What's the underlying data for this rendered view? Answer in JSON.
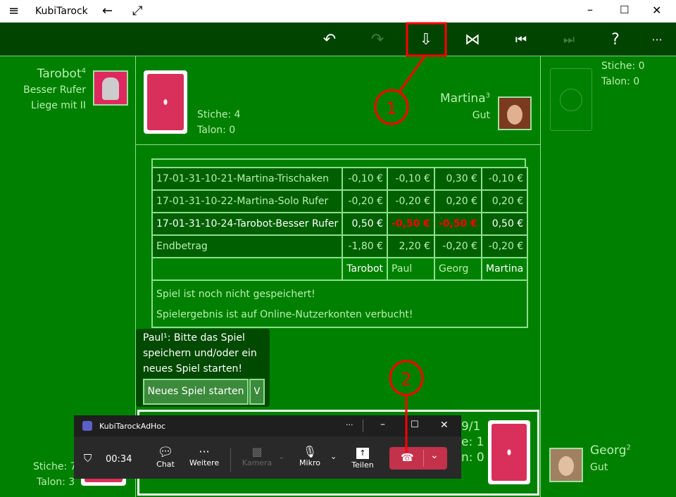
{
  "window": {
    "title": "KubiTarock",
    "menu_icon": "hamburger-icon",
    "back_icon": "arrow-left-icon",
    "expand_icon": "expand-icon"
  },
  "toolbar": {
    "buttons": [
      {
        "name": "undo-icon",
        "glyph": "↶"
      },
      {
        "name": "redo-icon",
        "glyph": "↷"
      },
      {
        "name": "save-icon",
        "glyph": "⇩"
      },
      {
        "name": "bowtie-icon",
        "glyph": "⋈"
      },
      {
        "name": "skip-back-icon",
        "glyph": "⏮"
      },
      {
        "name": "skip-forward-icon",
        "glyph": "⏭"
      },
      {
        "name": "help-icon",
        "glyph": "?"
      },
      {
        "name": "more-icon",
        "glyph": "···"
      }
    ]
  },
  "players": {
    "left": {
      "name": "Tarobot",
      "sup": "4",
      "line1": "Besser Rufer",
      "line2": "Liege mit II",
      "stiche": "Stiche: 7",
      "talon": "Talon: 3"
    },
    "top": {
      "name": "Martina",
      "sup": "3",
      "line1": "Gut",
      "stiche": "Stiche: 4",
      "talon": "Talon: 0"
    },
    "right": {
      "stiche": "Stiche: 0",
      "talon": "Talon: 0"
    },
    "bottom_right": {
      "name": "Georg",
      "sup": "2",
      "line1": "Gut"
    },
    "bottom": {
      "l1": "9/1",
      "l2": "e: 1",
      "l3": "n: 0"
    }
  },
  "table": {
    "rows": [
      {
        "name": "17-01-31-10-21-Martina-Trischaken",
        "v": [
          "-0,10 €",
          "-0,10 €",
          "0,30 €",
          "-0,10 €"
        ]
      },
      {
        "name": "17-01-31-10-22-Martina-Solo Rufer",
        "v": [
          "-0,20 €",
          "-0,20 €",
          "0,20 €",
          "0,20 €"
        ]
      },
      {
        "name": "17-01-31-10-24-Tarobot-Besser Rufer",
        "v": [
          "0,50 €",
          "-0,50 €",
          "-0,50 €",
          "0,50 €"
        ]
      }
    ],
    "total": {
      "name": "Endbetrag",
      "v": [
        "-1,80 €",
        "2,20 €",
        "-0,20 €",
        "-0,20 €"
      ]
    },
    "headers": [
      "Tarobot",
      "Paul",
      "Georg",
      "Martina"
    ],
    "msg1": "Spiel ist noch nicht gespeichert!",
    "msg2": "Spielergebnis ist auf Online-Nutzerkonten verbucht!",
    "negative_color": "#ff0000"
  },
  "prompt": {
    "text": "Paul¹: Bitte das Spiel speichern und/oder ein neues Spiel starten!",
    "button": "Neues Spiel starten",
    "dropdown": "V"
  },
  "teams": {
    "title": "KubiTarockAdHoc",
    "timer": "00:34",
    "chat": "Chat",
    "more": "Weitere",
    "camera": "Kamera",
    "mic": "Mikro",
    "share": "Teilen",
    "hangup_color": "#c4314b"
  },
  "annotations": {
    "one": "1",
    "two": "2",
    "color": "#ff0000"
  }
}
